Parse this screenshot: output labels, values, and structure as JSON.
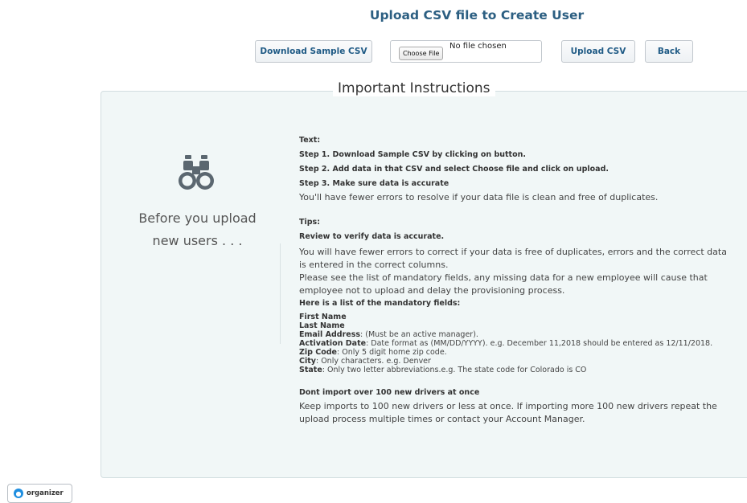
{
  "header": {
    "title": "Upload CSV file to Create User"
  },
  "toolbar": {
    "download_label": "Download Sample CSV",
    "choose_file_label": "Choose File",
    "file_status": "No file chosen",
    "upload_label": "Upload CSV",
    "back_label": "Back"
  },
  "panel": {
    "legend": "Important Instructions",
    "left_line1": "Before you upload",
    "left_line2": "new users . . .",
    "text_heading": "Text:",
    "step1": "Step 1. Download Sample CSV by clicking on button.",
    "step2": "Step 2. Add data in that CSV and select Choose file and click on upload.",
    "step3": "Step 3. Make sure data is accurate",
    "step3_note": "You'll have fewer errors to resolve if your data file is clean and free of duplicates.",
    "tips_heading": "Tips:",
    "tip_title": "Review to verify data is accurate.",
    "tip_p1": "You will have fewer errors to correct if your data is free of duplicates, errors and the correct data is entered in the correct columns.",
    "tip_p2": "Please see the list of mandatory fields, any missing data for a new employee will cause that employee not to upload and delay the provisioning process.",
    "mandatory_heading": "Here is a list of the mandatory fields:",
    "fields": {
      "first_name": "First Name",
      "last_name": "Last Name",
      "email_label": "Email Address",
      "email_desc": ": (Must be an active manager).",
      "activation_label": "Activation Date",
      "activation_desc": ": Date format as (MM/DD/YYYY). e.g. December 11,2018 should be entered as 12/11/2018.",
      "zip_label": "Zip Code",
      "zip_desc": ": Only 5 digit home zip code.",
      "city_label": "City",
      "city_desc": ": Only characters. e.g. Denver",
      "state_label": "State",
      "state_desc": ": Only two letter abbreviations.e.g. The state code for Colorado is CO"
    },
    "import_heading": "Dont import over 100 new drivers at once",
    "import_p": "Keep imports to 100 new drivers or less at once. If importing more 100 new drivers repeat the upload process multiple times or contact your Account Manager."
  },
  "footer": {
    "badge_label": "organizer",
    "badge_icon": "cloud-logo-icon"
  },
  "colors": {
    "title": "#2c5f82",
    "button_text": "#1f5a85",
    "panel_bg": "#f1f7f7",
    "badge_logo": "#1e8ee0"
  }
}
